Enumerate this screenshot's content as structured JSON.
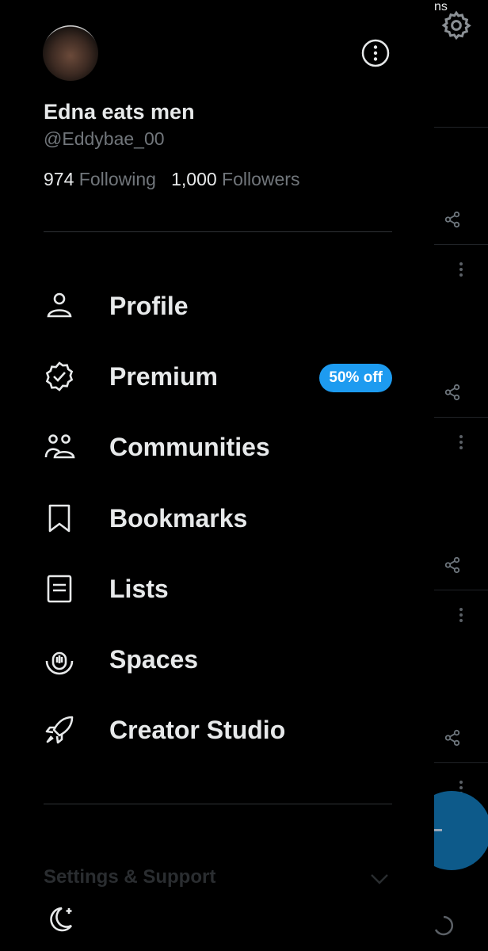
{
  "profile": {
    "display_name": "Edna eats men",
    "handle": "@Eddybae_00",
    "following_count": "974",
    "following_label": "Following",
    "followers_count": "1,000",
    "followers_label": "Followers"
  },
  "menu": [
    {
      "label": "Profile",
      "icon": "person-icon"
    },
    {
      "label": "Premium",
      "icon": "verified-badge-icon",
      "badge": "50% off"
    },
    {
      "label": "Communities",
      "icon": "communities-icon"
    },
    {
      "label": "Bookmarks",
      "icon": "bookmark-icon"
    },
    {
      "label": "Lists",
      "icon": "list-icon"
    },
    {
      "label": "Spaces",
      "icon": "spaces-icon"
    },
    {
      "label": "Creator Studio",
      "icon": "rocket-icon"
    }
  ],
  "settings_support_label": "Settings & Support",
  "background": {
    "tab_fragment": "ns"
  },
  "colors": {
    "accent": "#1d9bf0",
    "background": "#000000",
    "text_primary": "#e7e9ea",
    "text_secondary": "#71767b"
  }
}
